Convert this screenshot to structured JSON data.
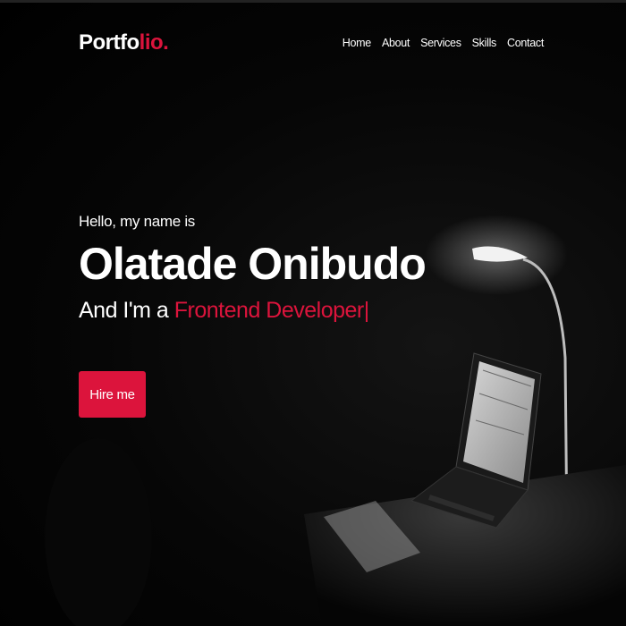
{
  "navbar": {
    "logo_main": "Portfo",
    "logo_accent": "lio.",
    "links": [
      "Home",
      "About",
      "Services",
      "Skills",
      "Contact"
    ]
  },
  "hero": {
    "greeting": "Hello, my name is",
    "name": "Olatade Onibudo",
    "role_prefix": "And I'm a ",
    "role_typed": "Frontend Developer",
    "cursor": "|",
    "cta_label": "Hire me"
  },
  "colors": {
    "accent": "#dc143c",
    "background": "#000000",
    "text": "#ffffff"
  },
  "icons": [
    "desk-lamp-illustration",
    "laptop-illustration"
  ]
}
